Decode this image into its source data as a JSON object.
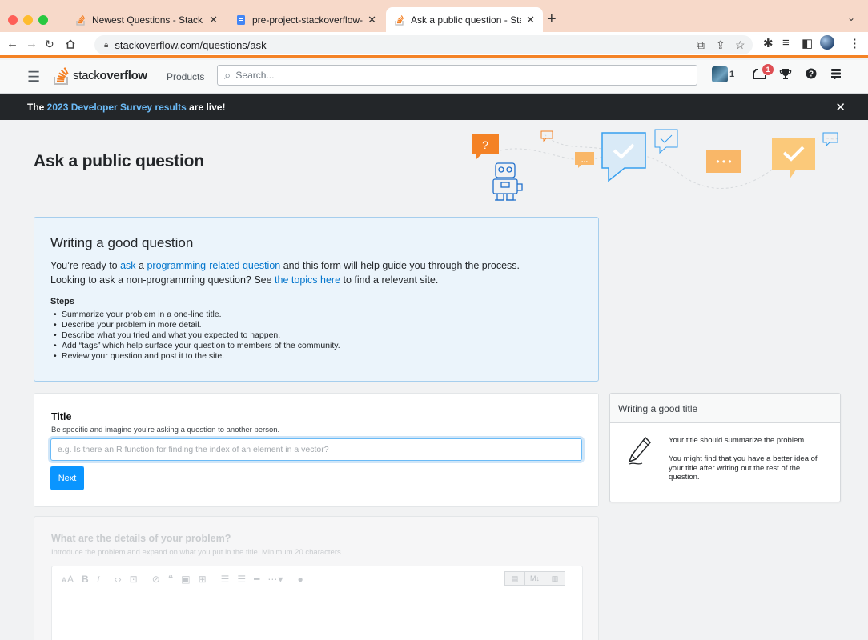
{
  "browser": {
    "tabs": [
      {
        "title": "Newest Questions - Stack Ove",
        "favicon": "stackoverflow-icon",
        "active": false
      },
      {
        "title": "pre-project-stackoverflow-clon",
        "favicon": "google-docs-icon",
        "active": false
      },
      {
        "title": "Ask a public question - Stack C",
        "favicon": "stackoverflow-icon",
        "active": true
      }
    ],
    "url": "stackoverflow.com/questions/ask",
    "accent": "#f48225"
  },
  "header": {
    "logo_text_light": "stack",
    "logo_text_bold": "overflow",
    "products": "Products",
    "search_placeholder": "Search...",
    "reputation": "1",
    "inbox_count": "1"
  },
  "notice": {
    "prefix": "The ",
    "link": "2023 Developer Survey results",
    "suffix": " are live!",
    "close": "✕"
  },
  "page": {
    "title": "Ask a public question"
  },
  "guide": {
    "heading": "Writing a good question",
    "line1_a": "You’re ready to ",
    "line1_link1": "ask",
    "line1_b": " a ",
    "line1_link2": "programming-related question",
    "line1_c": " and this form will help guide you through the process.",
    "line2_a": "Looking to ask a non-programming question? See ",
    "line2_link": "the topics here",
    "line2_b": " to find a relevant site.",
    "steps_heading": "Steps",
    "steps": [
      "Summarize your problem in a one-line title.",
      "Describe your problem in more detail.",
      "Describe what you tried and what you expected to happen.",
      "Add “tags” which help surface your question to members of the community.",
      "Review your question and post it to the site."
    ]
  },
  "title_form": {
    "label": "Title",
    "description": "Be specific and imagine you’re asking a question to another person.",
    "placeholder": "e.g. Is there an R function for finding the index of an element in a vector?",
    "next": "Next"
  },
  "sidebar": {
    "heading": "Writing a good title",
    "text1": "Your title should summarize the problem.",
    "text2": "You might find that you have a better idea of your title after writing out the rest of the question."
  },
  "details_form": {
    "label": "What are the details of your problem?",
    "description": "Introduce the problem and expand on what you put in the title. Minimum 20 characters.",
    "toolbar": [
      "AA",
      "B",
      "I",
      "<>",
      "{}",
      "link",
      "quote",
      "image",
      "table",
      "ol",
      "ul",
      "hr",
      "more",
      "help"
    ]
  }
}
